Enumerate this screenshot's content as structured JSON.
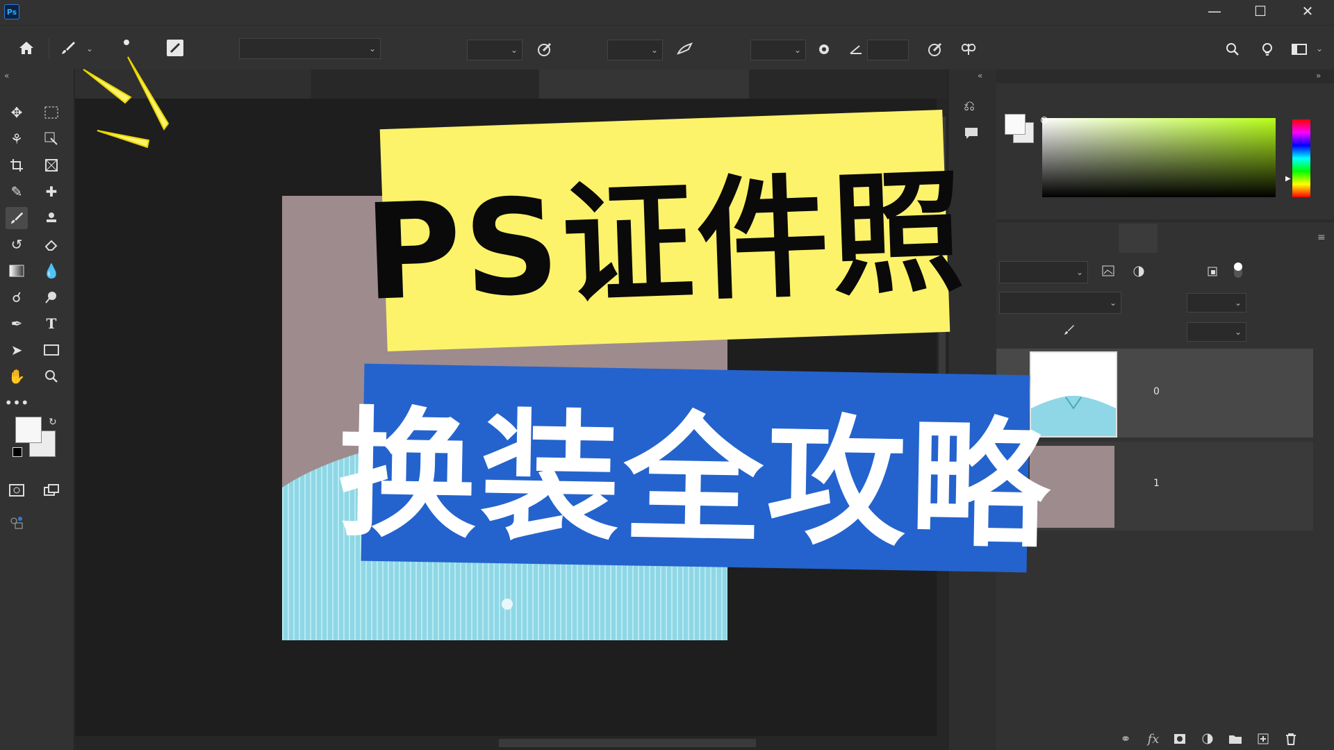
{
  "app": {
    "logo_text": "Ps"
  },
  "window_controls": {
    "minimize": "—",
    "maximize": "☐",
    "close": "✕"
  },
  "icons": {
    "home": "home-icon",
    "brush": "brush-icon",
    "search": "search-icon",
    "bulb": "light-bulb-icon",
    "workspace": "workspace-icon",
    "settings": "gear-icon",
    "angle": "angle-icon"
  },
  "title_overlay": {
    "line1": "PS证件照",
    "line2": "换装全攻略"
  },
  "layers": [
    {
      "name": "0"
    },
    {
      "name": "1"
    }
  ],
  "colors": {
    "accent_yellow": "#fdf36a",
    "accent_blue": "#2463cd",
    "photo_bg": "#9e8b8d",
    "shirt": "#8fd7e6"
  }
}
